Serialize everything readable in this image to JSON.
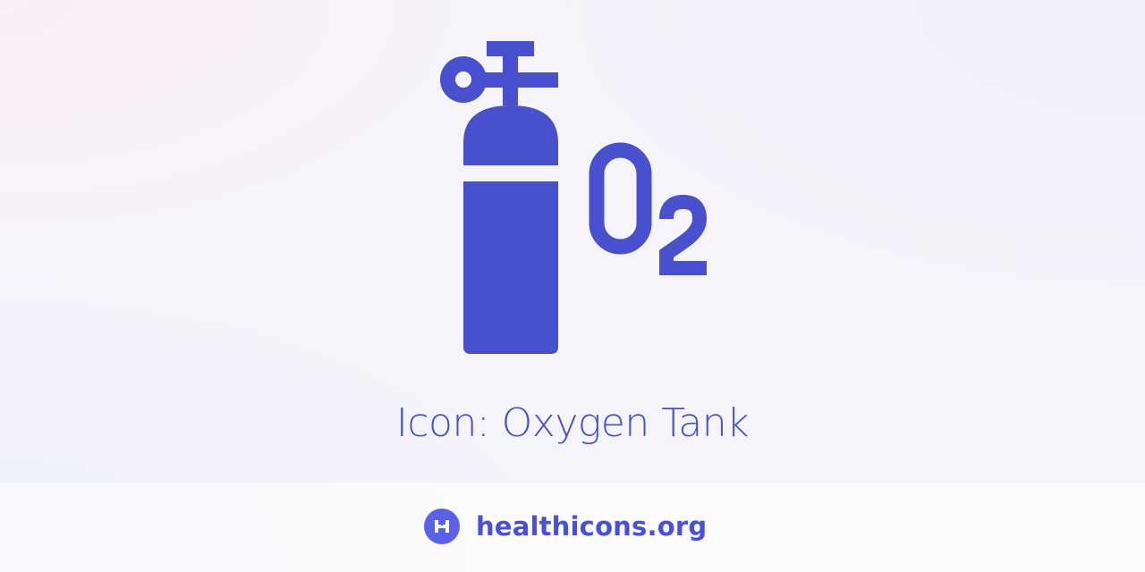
{
  "icon": {
    "name": "oxygen-tank-icon",
    "label": "O",
    "subscript": "2",
    "color": "#4850cd"
  },
  "title": "Icon: Oxygen Tank",
  "footer": {
    "logo_icon": "healthicons-logo-icon",
    "site": "healthicons.org",
    "accent_color": "#5b60e8"
  }
}
